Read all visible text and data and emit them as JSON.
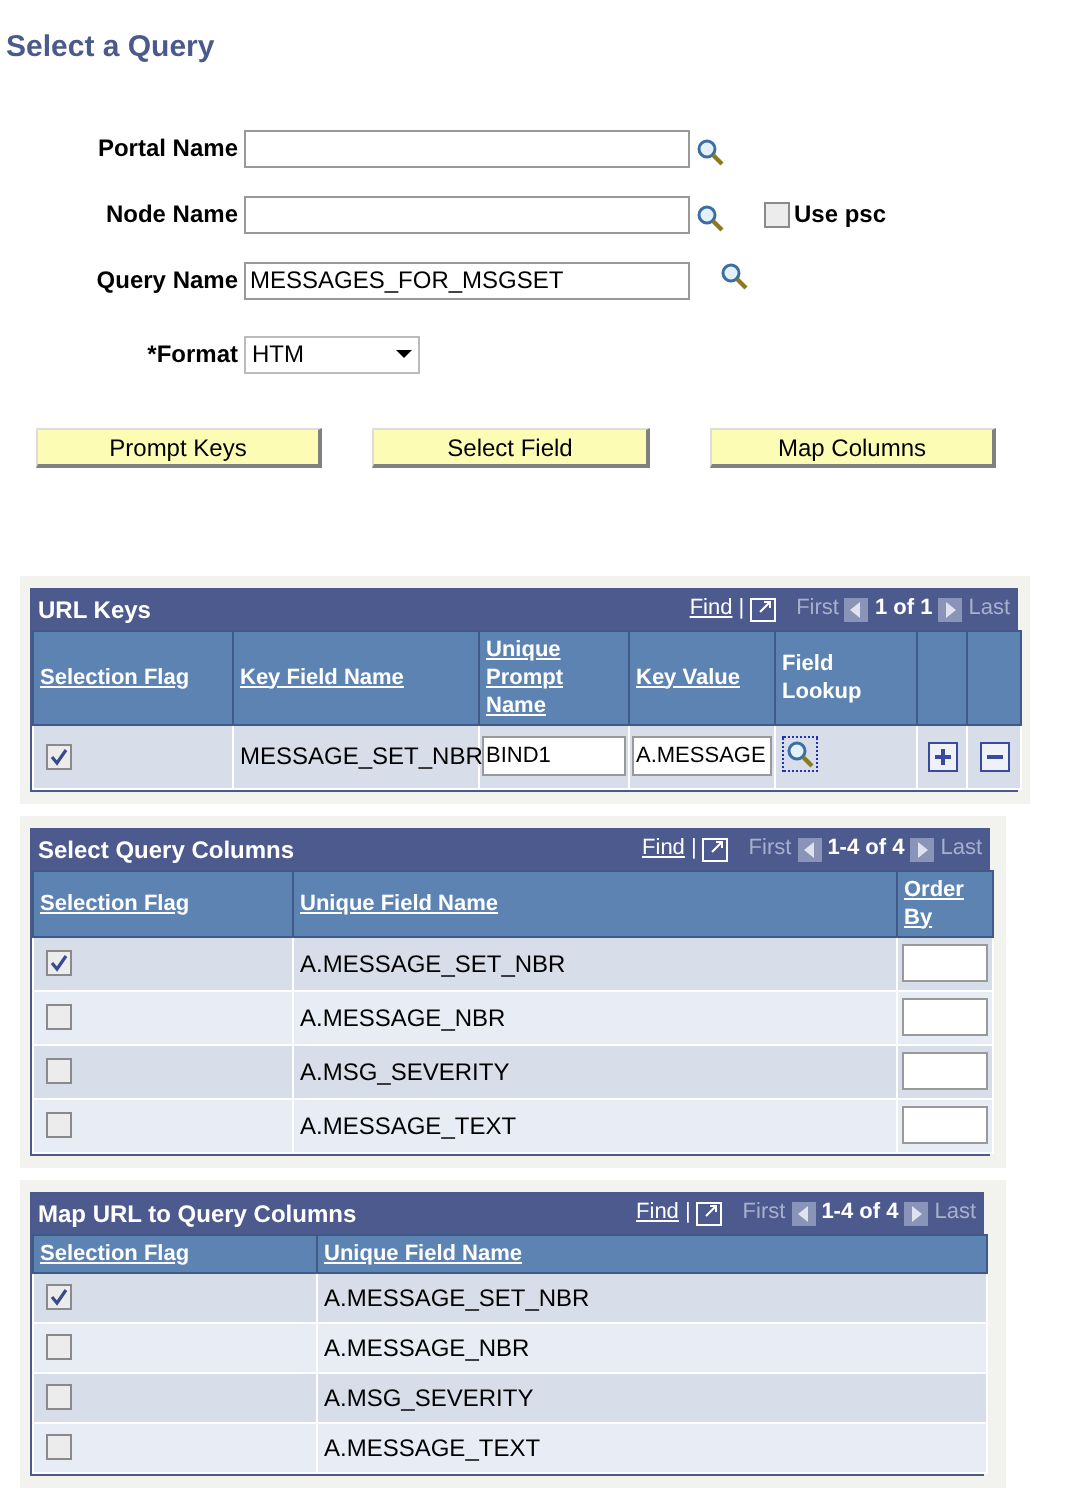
{
  "title": "Select a Query",
  "fields": [
    {
      "label": "Portal Name",
      "kind": "lookup"
    },
    {
      "label": "Node Name",
      "kind": "lookup_psc"
    },
    {
      "label": "Query Name",
      "value": "MESSAGES_FOR_MSGSET",
      "kind": "lookup_far"
    },
    {
      "label": "*Format",
      "value": "HTM",
      "kind": "select"
    }
  ],
  "use_psc": {
    "label": "Use psc",
    "checked": false
  },
  "buttons": [
    "Prompt Keys",
    "Select Field",
    "Map Columns"
  ],
  "grids": [
    {
      "title": "URL Keys",
      "find": "Find",
      "separator": "|",
      "first": "First",
      "range": "1 of 1",
      "last": "Last",
      "columns": [
        {
          "label": "Selection Flag",
          "link": true,
          "kind": "check"
        },
        {
          "label": "Key Field Name",
          "link": true,
          "kind": "text"
        },
        {
          "label": "Unique Prompt Name",
          "link": true,
          "kind": "input"
        },
        {
          "label": "Key Value",
          "link": true,
          "kind": "input"
        },
        {
          "label": "Field Lookup",
          "link": false,
          "kind": "lookup"
        },
        {
          "kind": "add"
        },
        {
          "kind": "delete"
        }
      ],
      "rows": [
        {
          "checked": true,
          "cells": [
            "",
            "MESSAGE_SET_NBR",
            "BIND1",
            "A.MESSAGE"
          ]
        }
      ]
    },
    {
      "title": "Select Query Columns",
      "find": "Find",
      "separator": "|",
      "first": "First",
      "range": "1-4 of 4",
      "last": "Last",
      "columns": [
        {
          "label": "Selection Flag",
          "link": true,
          "kind": "check"
        },
        {
          "label": "Unique Field Name",
          "link": true,
          "kind": "text"
        },
        {
          "label": "Order By",
          "link": true,
          "kind": "order"
        }
      ],
      "rows": [
        {
          "checked": true,
          "cells": [
            "",
            "A.MESSAGE_SET_NBR"
          ]
        },
        {
          "checked": false,
          "cells": [
            "",
            "A.MESSAGE_NBR"
          ]
        },
        {
          "checked": false,
          "cells": [
            "",
            "A.MSG_SEVERITY"
          ]
        },
        {
          "checked": false,
          "cells": [
            "",
            "A.MESSAGE_TEXT"
          ]
        }
      ]
    },
    {
      "title": "Map URL to Query Columns",
      "find": "Find",
      "separator": "|",
      "first": "First",
      "range": "1-4 of 4",
      "last": "Last",
      "columns": [
        {
          "label": "Selection Flag",
          "link": true,
          "kind": "check"
        },
        {
          "label": "Unique Field Name",
          "link": true,
          "kind": "text"
        }
      ],
      "rows": [
        {
          "checked": true,
          "cells": [
            "",
            "A.MESSAGE_SET_NBR"
          ]
        },
        {
          "checked": false,
          "cells": [
            "",
            "A.MESSAGE_NBR"
          ]
        },
        {
          "checked": false,
          "cells": [
            "",
            "A.MSG_SEVERITY"
          ]
        },
        {
          "checked": false,
          "cells": [
            "",
            "A.MESSAGE_TEXT"
          ]
        }
      ]
    }
  ]
}
